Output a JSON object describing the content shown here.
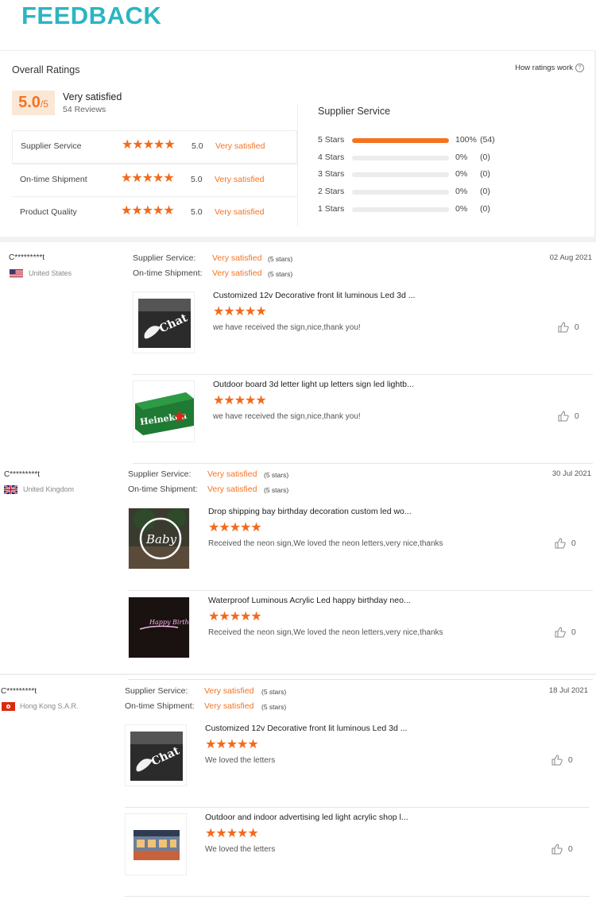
{
  "page_title": "FEEDBACK",
  "summary": {
    "overall_label": "Overall Ratings",
    "how_ratings_label": "How ratings work",
    "score": "5.0",
    "score_suffix": "/5",
    "score_text": "Very satisfied",
    "reviews_count": "54 Reviews",
    "metrics": [
      {
        "name": "Supplier Service",
        "stars": "★★★★★",
        "value": "5.0",
        "label": "Very satisfied"
      },
      {
        "name": "On-time Shipment",
        "stars": "★★★★★",
        "value": "5.0",
        "label": "Very satisfied"
      },
      {
        "name": "Product Quality",
        "stars": "★★★★★",
        "value": "5.0",
        "label": "Very satisfied"
      }
    ],
    "supplier_service_title": "Supplier Service",
    "distribution": [
      {
        "label": "5  Stars",
        "fraction": 1.0,
        "pct": "100%",
        "count": "(54)"
      },
      {
        "label": "4  Stars",
        "fraction": 0,
        "pct": "0%",
        "count": "(0)"
      },
      {
        "label": "3  Stars",
        "fraction": 0,
        "pct": "0%",
        "count": "(0)"
      },
      {
        "label": "2  Stars",
        "fraction": 0,
        "pct": "0%",
        "count": "(0)"
      },
      {
        "label": "1  Stars",
        "fraction": 0,
        "pct": "0%",
        "count": "(0)"
      }
    ],
    "accent_color": "#f47321"
  },
  "reviews": [
    {
      "user": "C*********t",
      "country": "United States",
      "flag": "us-flag",
      "supplier_service_label": "Supplier Service:",
      "supplier_service_value": "Very satisfied",
      "supplier_service_stars": "(5 stars)",
      "shipment_label": "On-time Shipment:",
      "shipment_value": "Very satisfied",
      "shipment_stars": "(5 stars)",
      "date": "02 Aug 2021",
      "items": [
        {
          "title": "Customized 12v Decorative front lit luminous Led 3d ...",
          "stars": "★★★★★",
          "comment": "we have received the sign,nice,thank you!",
          "likes": "0",
          "thumb": "chat-sign"
        },
        {
          "title": "Outdoor board 3d letter light up letters sign led lightb...",
          "stars": "★★★★★",
          "comment": "we have received the sign,nice,thank you!",
          "likes": "0",
          "thumb": "heineken-sign",
          "thumb_text": "Heineken"
        }
      ]
    },
    {
      "user": "C*********t",
      "country": "United Kingdom",
      "flag": "uk-flag",
      "supplier_service_label": "Supplier Service:",
      "supplier_service_value": "Very satisfied",
      "supplier_service_stars": "(5 stars)",
      "shipment_label": "On-time Shipment:",
      "shipment_value": "Very satisfied",
      "shipment_stars": "(5 stars)",
      "date": "30 Jul 2021",
      "items": [
        {
          "title": "Drop shipping bay birthday decoration custom led wo...",
          "stars": "★★★★★",
          "comment": "Received the neon sign,We loved the neon letters,very nice,thanks",
          "likes": "0",
          "thumb": "baby-neon",
          "thumb_text": "Baby"
        },
        {
          "title": "Waterproof Luminous Acrylic Led happy birthday neo...",
          "stars": "★★★★★",
          "comment": "Received the neon sign,We loved the neon letters,very nice,thanks",
          "likes": "0",
          "thumb": "birthday-neon",
          "thumb_text": "Happy Birthday"
        }
      ]
    },
    {
      "user": "C*********t",
      "country": "Hong Kong S.A.R.",
      "flag": "hk-flag",
      "supplier_service_label": "Supplier Service:",
      "supplier_service_value": "Very satisfied",
      "supplier_service_stars": "(5 stars)",
      "shipment_label": "On-time Shipment:",
      "shipment_value": "Very satisfied",
      "shipment_stars": "(5 stars)",
      "date": "18 Jul 2021",
      "items": [
        {
          "title": "Customized 12v Decorative front lit luminous Led 3d ...",
          "stars": "★★★★★",
          "comment": "We loved the letters",
          "likes": "0",
          "thumb": "chat-sign"
        },
        {
          "title": "Outdoor and indoor advertising led light acrylic shop l...",
          "stars": "★★★★★",
          "comment": "We loved the letters",
          "likes": "0",
          "thumb": "shop-front"
        }
      ]
    }
  ]
}
